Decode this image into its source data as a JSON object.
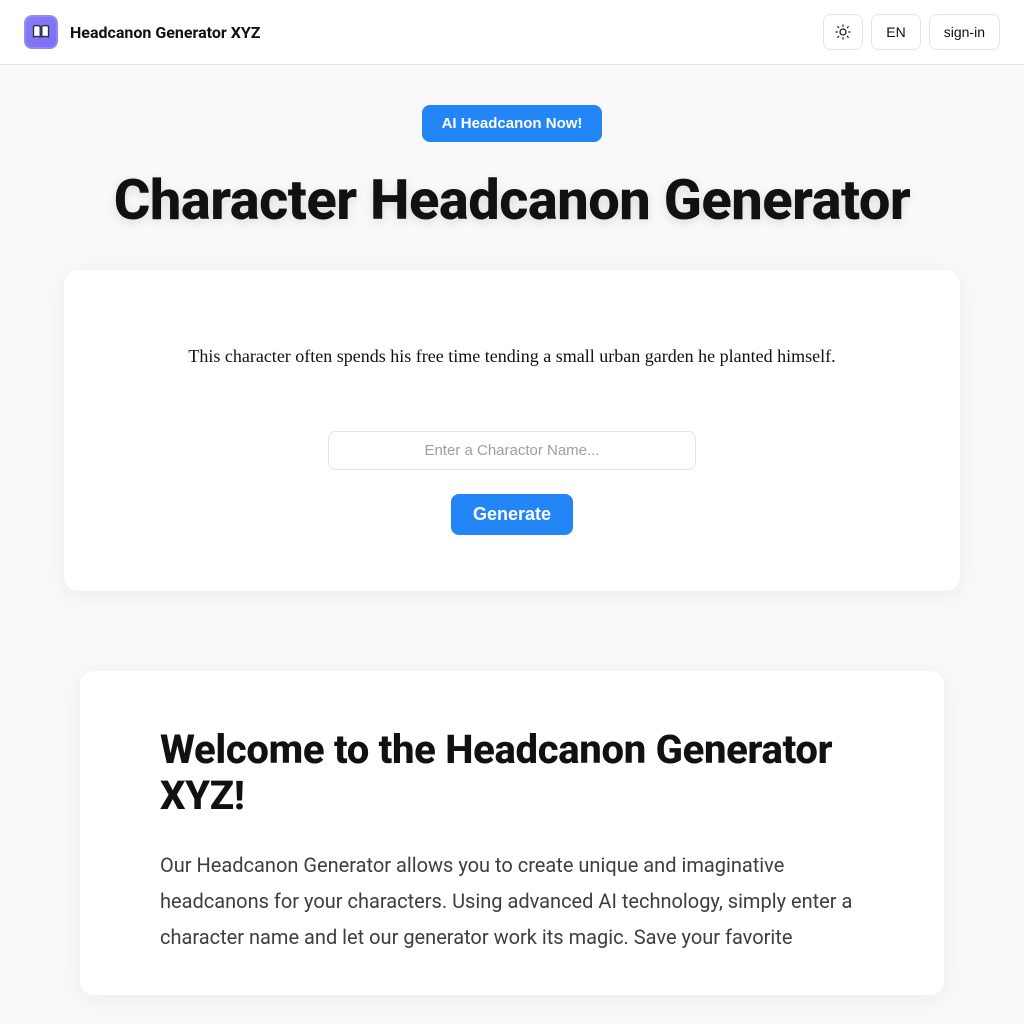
{
  "header": {
    "appTitle": "Headcanon Generator XYZ",
    "language": "EN",
    "signIn": "sign-in"
  },
  "hero": {
    "pillLabel": "AI Headcanon Now!",
    "title": "Character Headcanon Generator"
  },
  "generator": {
    "sampleHeadcanon": "This character often spends his free time tending a small urban garden he planted himself.",
    "inputPlaceholder": "Enter a Charactor Name...",
    "inputValue": "",
    "generateLabel": "Generate"
  },
  "welcome": {
    "heading": "Welcome to the Headcanon Generator XYZ!",
    "body": "Our Headcanon Generator allows you to create unique and imaginative headcanons for your characters. Using advanced AI technology, simply enter a character name and let our generator work its magic. Save your favorite"
  }
}
